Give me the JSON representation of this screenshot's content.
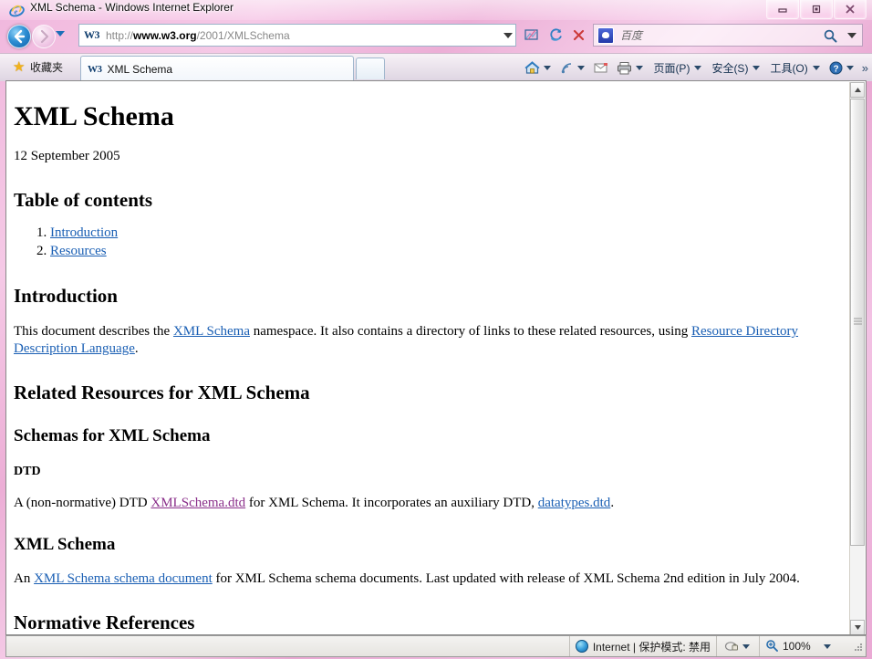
{
  "window": {
    "title": "XML Schema - Windows Internet Explorer",
    "minimize_label": "Minimize",
    "restore_label": "Restore",
    "close_label": "Close"
  },
  "nav": {
    "back_label": "Back",
    "forward_label": "Forward",
    "recent_pages_label": "Recent Pages",
    "url_prefix": "http://",
    "url_host": "www.w3.org",
    "url_path": "/2001/XMLSchema",
    "url_full": "http://www.w3.org/2001/XMLSchema",
    "site_icon_label": "W3",
    "address_dropdown_label": "Address dropdown",
    "compatibility_label": "Compatibility View",
    "refresh_label": "Refresh",
    "stop_label": "Stop"
  },
  "search": {
    "provider": "百度",
    "placeholder": "百度",
    "go_label": "Search",
    "dropdown_label": "Search provider dropdown"
  },
  "tabs_bar": {
    "favorites_label": "收藏夹",
    "tab_icon_label": "W3",
    "tab_title": "XML Schema",
    "new_tab_label": "New Tab"
  },
  "command_bar": {
    "items": [
      {
        "name": "home",
        "label": "",
        "icon": "home-icon",
        "has_caret": true
      },
      {
        "name": "feeds",
        "label": "",
        "icon": "rss-icon",
        "has_caret": true
      },
      {
        "name": "mail",
        "label": "",
        "icon": "mail-icon",
        "has_caret": false
      },
      {
        "name": "print",
        "label": "",
        "icon": "printer-icon",
        "has_caret": true
      },
      {
        "name": "page",
        "label": "页面(P)",
        "icon": "",
        "has_caret": true
      },
      {
        "name": "safety",
        "label": "安全(S)",
        "icon": "",
        "has_caret": true
      },
      {
        "name": "tools",
        "label": "工具(O)",
        "icon": "",
        "has_caret": true
      },
      {
        "name": "help",
        "label": "",
        "icon": "help-icon",
        "has_caret": true
      }
    ],
    "overflow_label": "»"
  },
  "document": {
    "title": "XML Schema",
    "date": "12 September 2005",
    "toc_heading": "Table of contents",
    "toc_items": [
      {
        "label": "Introduction",
        "visited": false
      },
      {
        "label": "Resources",
        "visited": false
      }
    ],
    "intro_heading": "Introduction",
    "intro_paragraph": {
      "part1": "This document describes the ",
      "link1": "XML Schema",
      "part2": " namespace. It also contains a directory of links to these related resources, using ",
      "link2": "Resource Directory Description Language",
      "part3": "."
    },
    "related_heading": "Related Resources for XML Schema",
    "schemas_heading": "Schemas for XML Schema",
    "dtd_heading": "DTD",
    "dtd_paragraph": {
      "part1": "A (non-normative) DTD ",
      "link1": "XMLSchema.dtd",
      "part2": " for XML Schema. It incorporates an auxiliary DTD, ",
      "link2": "datatypes.dtd",
      "part3": "."
    },
    "xmlschema_heading": "XML Schema",
    "xmlschema_paragraph": {
      "part1": "An ",
      "link1": "XML Schema schema document",
      "part2": " for XML Schema schema documents. Last updated with release of XML Schema 2nd edition in July 2004."
    },
    "normative_heading": "Normative References"
  },
  "status": {
    "zone": "Internet | 保护模式: 禁用",
    "zone_icon": "internet-zone-icon",
    "security_icon": "privacy-report-icon",
    "zoom_level": "100%",
    "zoom_icon": "zoom-icon"
  },
  "colors": {
    "link": "#1a5fb4",
    "visited_link": "#8a2f8a",
    "frame_pink": "#efb0da",
    "tab_bg": "#ffffff"
  }
}
